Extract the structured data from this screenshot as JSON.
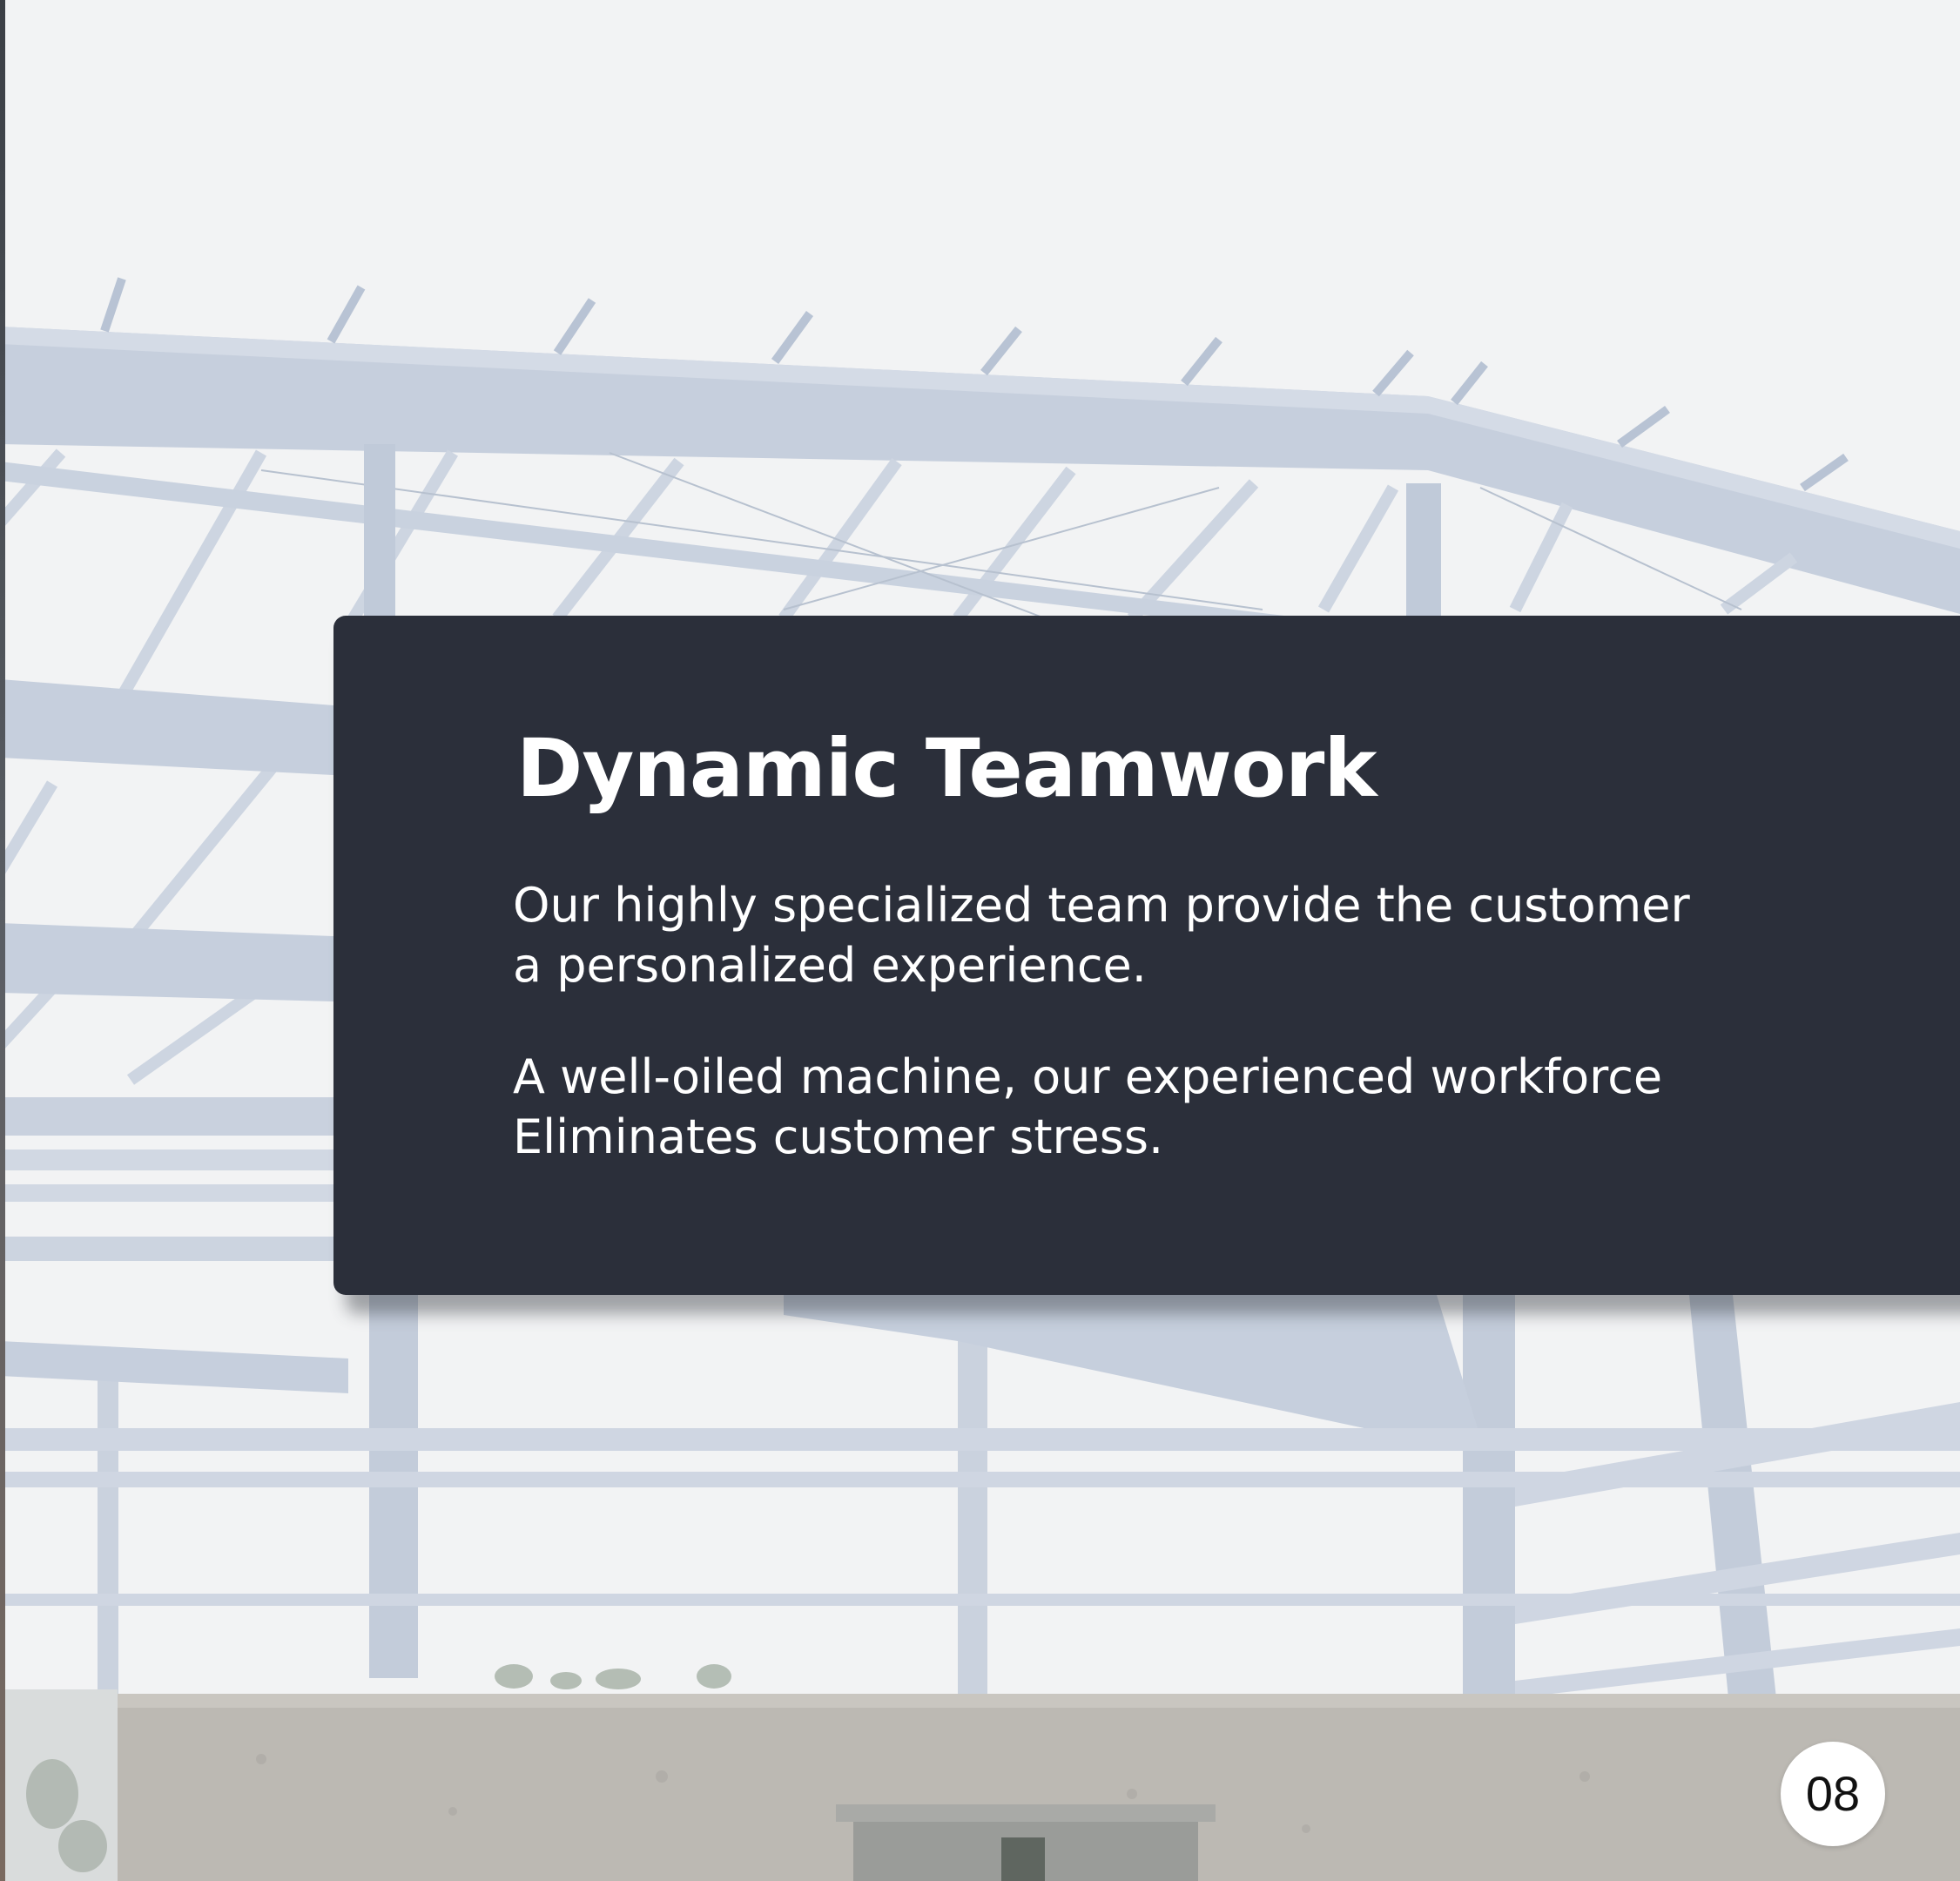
{
  "card": {
    "title": "Dynamic Teamwork",
    "paragraph1_line1": "Our highly specialized team provide the customer",
    "paragraph1_line2": "a personalized experience.",
    "paragraph2_line1": "A well-oiled machine, our experienced workforce",
    "paragraph2_line2": "Eliminates customer stress."
  },
  "page_number": "08",
  "colors": {
    "card_background": "#2b2f3a",
    "steel": "#c3cddb",
    "concrete": "#bdbab4"
  }
}
